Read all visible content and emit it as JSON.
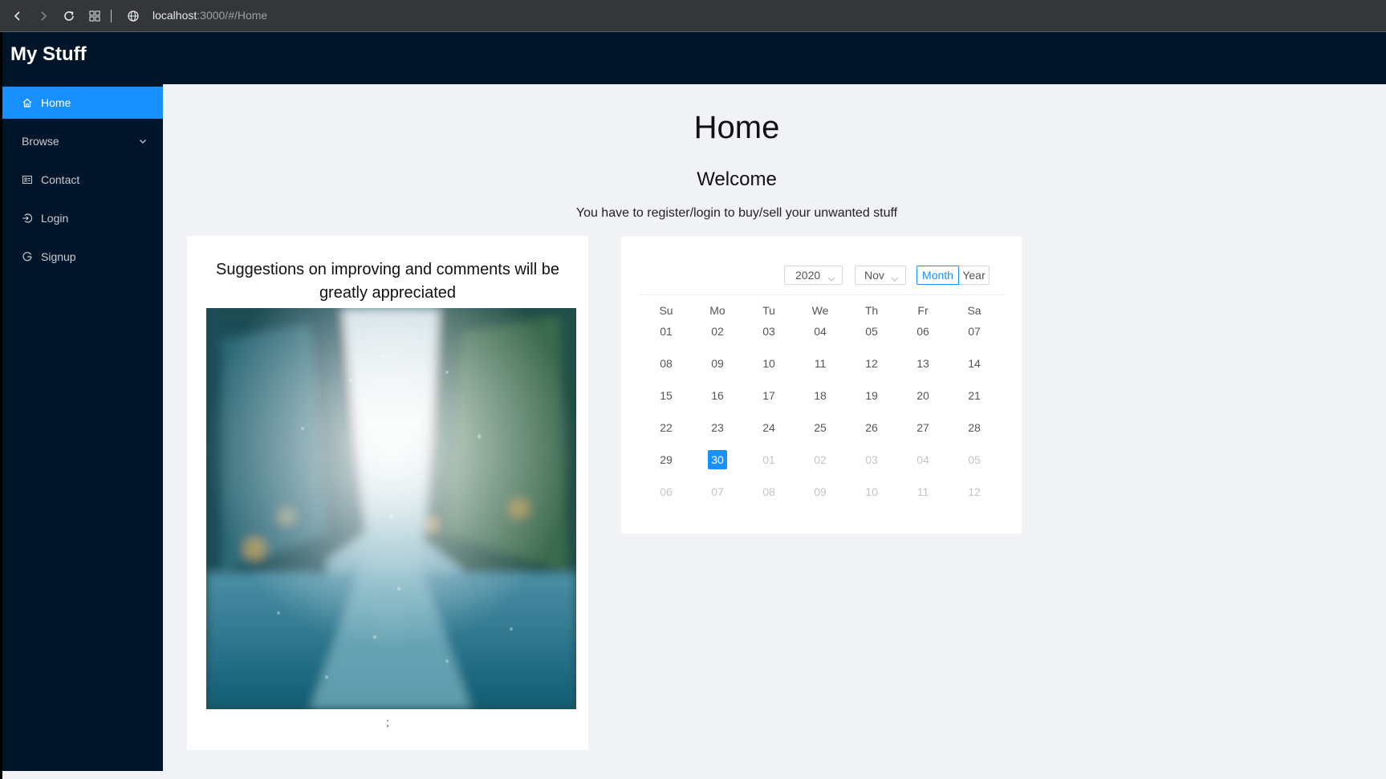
{
  "browser": {
    "url_host": "localhost",
    "url_path": ":3000/#/Home"
  },
  "header": {
    "brand": "My Stuff"
  },
  "sidebar": {
    "items": [
      {
        "label": "Home",
        "icon": "home-icon",
        "active": true
      },
      {
        "label": "Browse",
        "icon": "",
        "has_submenu": true
      },
      {
        "label": "Contact",
        "icon": "contact-card-icon"
      },
      {
        "label": "Login",
        "icon": "login-icon"
      },
      {
        "label": "Signup",
        "icon": "signup-icon"
      }
    ]
  },
  "main": {
    "title": "Home",
    "welcome": "Welcome",
    "intro": "You have to register/login to buy/sell your unwanted stuff"
  },
  "suggestions_card": {
    "title": "Suggestions on improving and comments will be greatly appreciated",
    "caption": ";"
  },
  "calendar": {
    "year": "2020",
    "month": "Nov",
    "mode_month": "Month",
    "mode_year": "Year",
    "weekdays": [
      "Su",
      "Mo",
      "Tu",
      "We",
      "Th",
      "Fr",
      "Sa"
    ],
    "weeks": [
      [
        "01",
        "02",
        "03",
        "04",
        "05",
        "06",
        "07"
      ],
      [
        "08",
        "09",
        "10",
        "11",
        "12",
        "13",
        "14"
      ],
      [
        "15",
        "16",
        "17",
        "18",
        "19",
        "20",
        "21"
      ],
      [
        "22",
        "23",
        "24",
        "25",
        "26",
        "27",
        "28"
      ],
      [
        "29",
        "30",
        "01",
        "02",
        "03",
        "04",
        "05"
      ],
      [
        "06",
        "07",
        "08",
        "09",
        "10",
        "11",
        "12"
      ]
    ],
    "today": "30",
    "accent_color": "#1890ff"
  }
}
